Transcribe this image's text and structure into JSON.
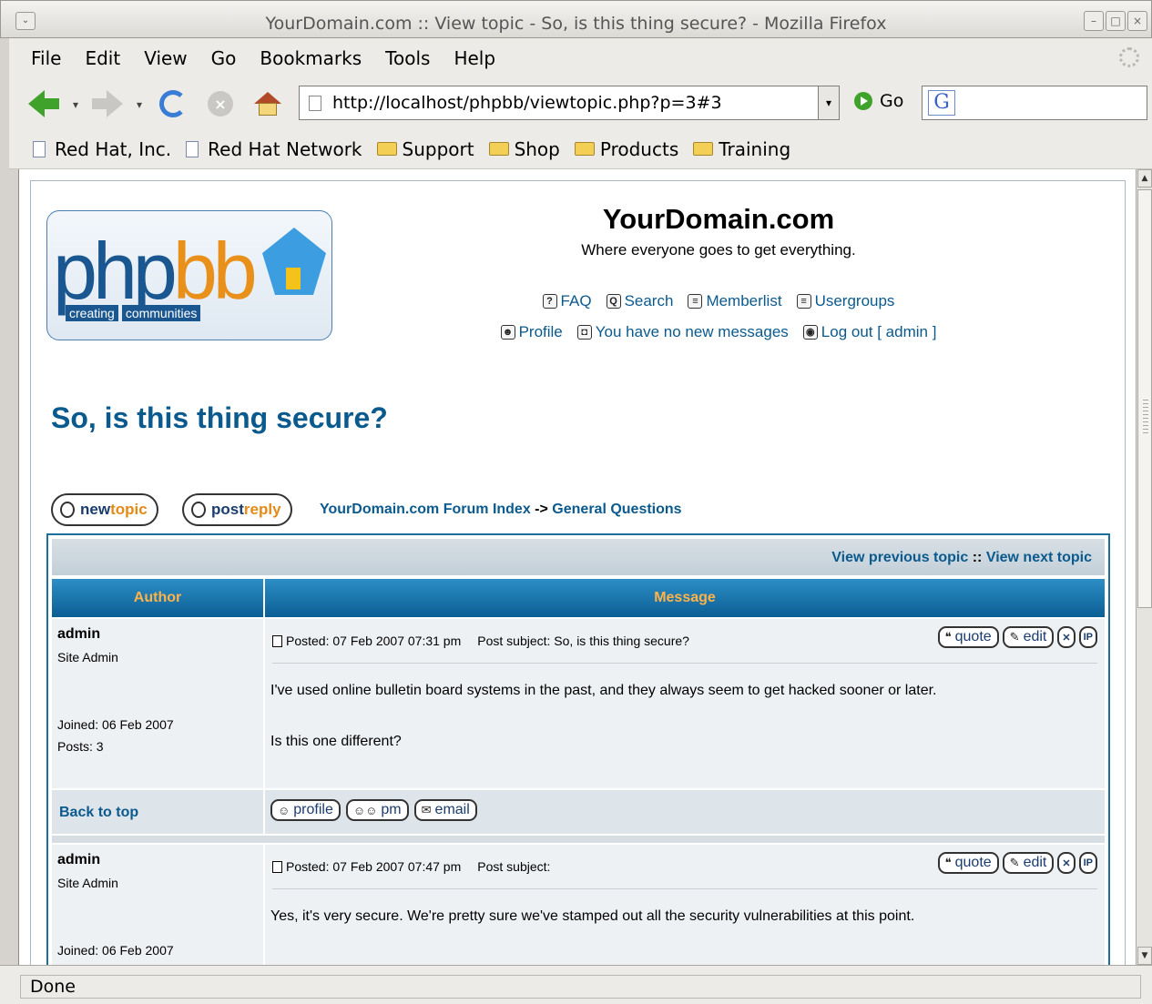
{
  "window": {
    "title": "YourDomain.com :: View topic - So, is this thing secure? - Mozilla Firefox"
  },
  "menubar": {
    "items": [
      {
        "label": "File"
      },
      {
        "label": "Edit"
      },
      {
        "label": "View"
      },
      {
        "label": "Go"
      },
      {
        "label": "Bookmarks"
      },
      {
        "label": "Tools"
      },
      {
        "label": "Help"
      }
    ]
  },
  "toolbar": {
    "url": "http://localhost/phpbb/viewtopic.php?p=3#3",
    "go_label": "Go",
    "search_glyph": "G"
  },
  "bookmarks": {
    "items": [
      {
        "label": "Red Hat, Inc.",
        "icon": "page-icon"
      },
      {
        "label": "Red Hat Network",
        "icon": "page-icon"
      },
      {
        "label": "Support",
        "icon": "folder-icon"
      },
      {
        "label": "Shop",
        "icon": "folder-icon"
      },
      {
        "label": "Products",
        "icon": "folder-icon"
      },
      {
        "label": "Training",
        "icon": "folder-icon"
      }
    ]
  },
  "page": {
    "logo": {
      "word_a": "php",
      "word_b": "bb",
      "tag_a": "creating",
      "tag_b": "communities"
    },
    "site_title": "YourDomain.com",
    "site_desc": "Where everyone goes to get everything.",
    "links_row1": [
      {
        "label": "FAQ",
        "glyph": "?"
      },
      {
        "label": "Search",
        "glyph": "Q"
      },
      {
        "label": "Memberlist",
        "glyph": "≡"
      },
      {
        "label": "Usergroups",
        "glyph": "≡"
      }
    ],
    "links_row2": [
      {
        "label": "Profile",
        "glyph": "☻"
      },
      {
        "label": "You have no new messages",
        "glyph": "◘"
      },
      {
        "label": "Log out [ admin ]",
        "glyph": "◉"
      }
    ],
    "topic_title": "So, is this thing secure?",
    "newtopic": {
      "a": "new",
      "b": "topic"
    },
    "postreply": {
      "a": "post",
      "b": "reply"
    },
    "nav": {
      "index": "YourDomain.com Forum Index",
      "sep": " -> ",
      "forum": "General Questions"
    },
    "cat": {
      "prev": "View previous topic",
      "sep": " :: ",
      "next": "View next topic"
    },
    "table_headers": {
      "author": "Author",
      "message": "Message"
    },
    "posts": [
      {
        "author": "admin",
        "rank": "Site Admin",
        "joined": "Joined: 06 Feb 2007",
        "posts": "Posts: 3",
        "posted": "Posted: 07 Feb 2007 07:31 pm",
        "subject": "Post subject: So, is this thing secure?",
        "lines": [
          "I've used online bulletin board systems in the past, and they always seem to get hacked sooner or later.",
          "Is this one different?"
        ]
      },
      {
        "author": "admin",
        "rank": "Site Admin",
        "joined": "Joined: 06 Feb 2007",
        "posted": "Posted: 07 Feb 2007 07:47 pm",
        "subject": "Post subject:",
        "lines": [
          "Yes, it's very secure. We're pretty sure we've stamped out all the security vulnerabilities at this point."
        ]
      }
    ],
    "post_actions": {
      "quote": "quote",
      "edit": "edit",
      "delete": "✕",
      "ip": "IP"
    },
    "back_to_top": "Back to top",
    "footer_buttons": {
      "profile": "profile",
      "pm": "pm",
      "email": "email"
    }
  },
  "status": {
    "text": "Done"
  }
}
